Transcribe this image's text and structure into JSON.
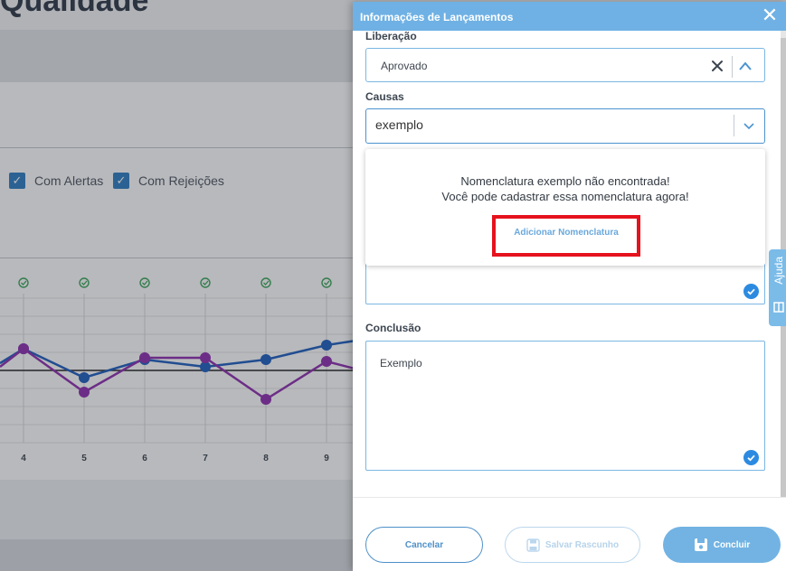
{
  "background": {
    "page_title": "Qualidade",
    "filters": [
      {
        "label": "Com Alertas",
        "checked": true
      },
      {
        "label": "Com Rejeições",
        "checked": true
      }
    ],
    "chart_data": {
      "type": "line",
      "categories": [
        "4",
        "5",
        "6",
        "7",
        "8",
        "9"
      ],
      "series": [
        {
          "color": "#1f5fbf",
          "values": [
            0.6,
            -0.2,
            0.3,
            0.1,
            0.3,
            0.7
          ]
        },
        {
          "color": "#8e2fb0",
          "values": [
            0.6,
            -0.6,
            0.35,
            0.35,
            -0.8,
            0.25
          ]
        }
      ],
      "status_icons": "check-circle-icon",
      "status_color": "#3aa65a"
    }
  },
  "drawer": {
    "title": "Informações de Lançamentos",
    "liberacao": {
      "label": "Liberação",
      "value": "Aprovado"
    },
    "causas": {
      "label": "Causas",
      "input_value": "exemplo",
      "not_found_line1": "Nomenclatura exemplo não encontrada!",
      "not_found_line2": "Você pode cadastrar essa nomenclatura agora!",
      "add_label": "Adicionar Nomenclatura"
    },
    "conclusao": {
      "label": "Conclusão",
      "value": "Exemplo"
    },
    "buttons": {
      "cancel": "Cancelar",
      "draft": "Salvar Rascunho",
      "done": "Concluir"
    }
  },
  "help_tab": {
    "label": "Ajuda"
  },
  "colors": {
    "accent": "#6fb1e4",
    "highlight": "#e5131d",
    "primary_button": "#72b3e3"
  }
}
